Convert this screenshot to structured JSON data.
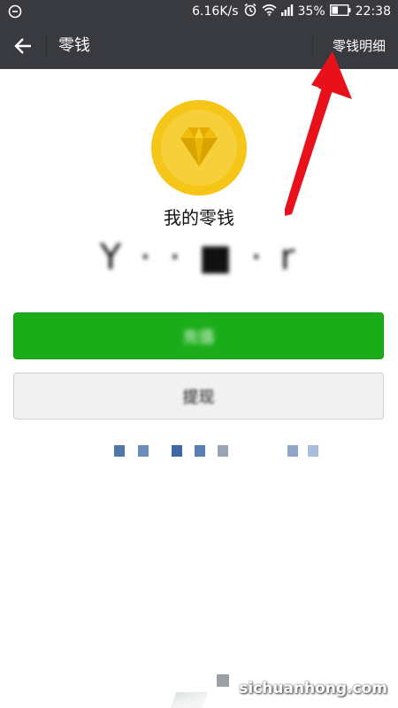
{
  "status_bar": {
    "network_speed": "6.16K/s",
    "battery": "35%",
    "time": "22:38",
    "icons": [
      "alarm-icon",
      "wifi-icon",
      "signal-icon",
      "battery-icon"
    ]
  },
  "title_bar": {
    "title": "零钱",
    "detail_link": "零钱明细",
    "back_icon": "arrow-left-icon"
  },
  "wallet": {
    "label": "我的零钱",
    "balance_obscured": "Y  ·  ·  ■  ·  r"
  },
  "buttons": {
    "recharge_label": "充值",
    "withdraw_label": "提现"
  },
  "watermark": "sichuanhong.com",
  "colors": {
    "header_bg": "#393a3f",
    "primary_green": "#1aad19",
    "coin_gold": "#f5c518",
    "annotation_red": "#e8111b"
  }
}
